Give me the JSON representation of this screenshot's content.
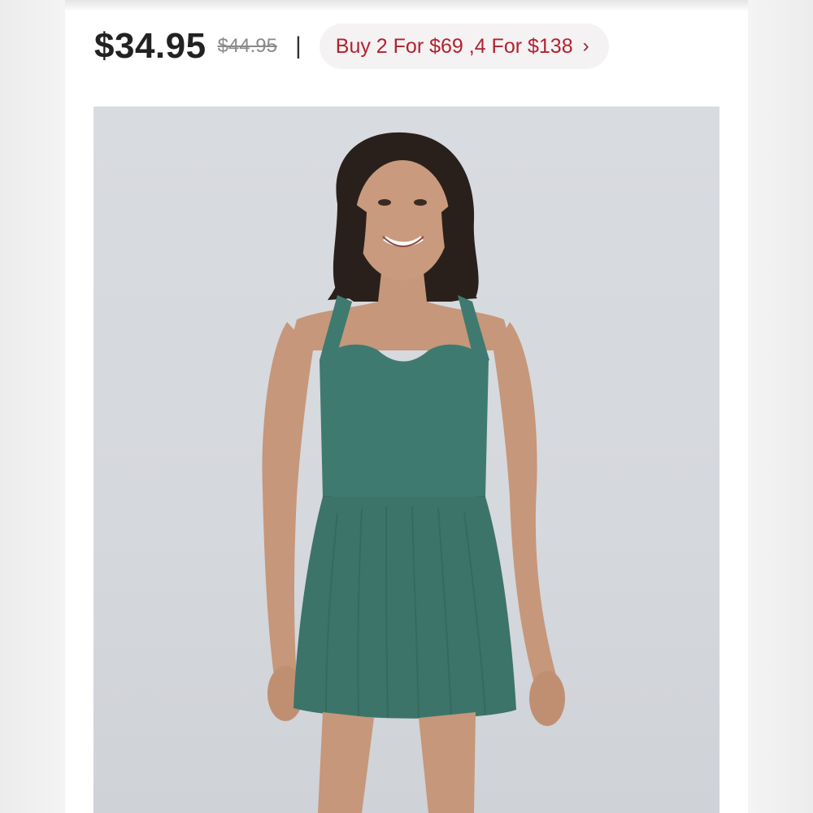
{
  "product": {
    "current_price": "$34.95",
    "original_price": "$44.95",
    "divider": "|",
    "promo_label": "Buy 2 For $69 ,4 For $138",
    "promo_chevron": "›"
  },
  "photo": {
    "subject": "model-wearing-teal-romper",
    "colors": {
      "background": "#d6d9de",
      "garment": "#3f7a70",
      "skin": "#c6977a",
      "hair": "#2a201b"
    }
  },
  "icons": {
    "promo_chevron": "chevron-right-icon"
  }
}
